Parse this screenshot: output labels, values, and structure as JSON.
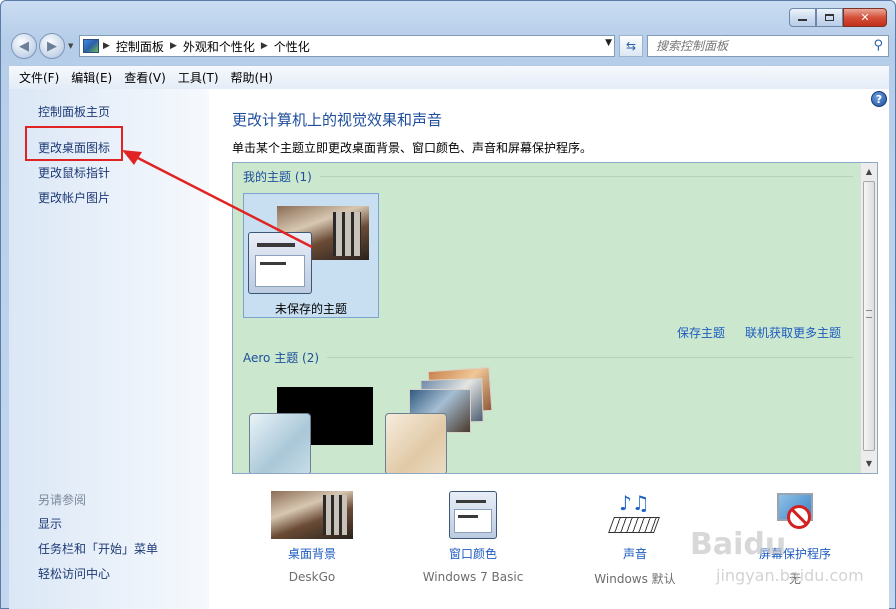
{
  "window": {
    "minimize": "▬",
    "maximize": "▢",
    "close": "✕"
  },
  "nav": {
    "back": "◀",
    "forward": "▶",
    "breadcrumb": [
      "控制面板",
      "外观和个性化",
      "个性化"
    ],
    "search_placeholder": "搜索控制面板"
  },
  "menubar": [
    "文件(F)",
    "编辑(E)",
    "查看(V)",
    "工具(T)",
    "帮助(H)"
  ],
  "sidebar": {
    "links": [
      "控制面板主页",
      "更改桌面图标",
      "更改鼠标指针",
      "更改帐户图片"
    ],
    "see_also_title": "另请参阅",
    "see_also": [
      "显示",
      "任务栏和「开始」菜单",
      "轻松访问中心"
    ]
  },
  "main": {
    "title": "更改计算机上的视觉效果和声音",
    "description": "单击某个主题立即更改桌面背景、窗口颜色、声音和屏幕保护程序。",
    "my_themes_header": "我的主题 (1)",
    "unsaved_theme": "未保存的主题",
    "save_theme": "保存主题",
    "get_more_themes": "联机获取更多主题",
    "aero_header": "Aero 主题 (2)"
  },
  "bottom": [
    {
      "label": "桌面背景",
      "value": "DeskGo"
    },
    {
      "label": "窗口颜色",
      "value": "Windows 7 Basic"
    },
    {
      "label": "声音",
      "value": "Windows 默认"
    },
    {
      "label": "屏幕保护程序",
      "value": "无"
    }
  ],
  "help_glyph": "?",
  "watermark": {
    "logo": "Baidu",
    "url": "jingyan.baidu.com"
  }
}
